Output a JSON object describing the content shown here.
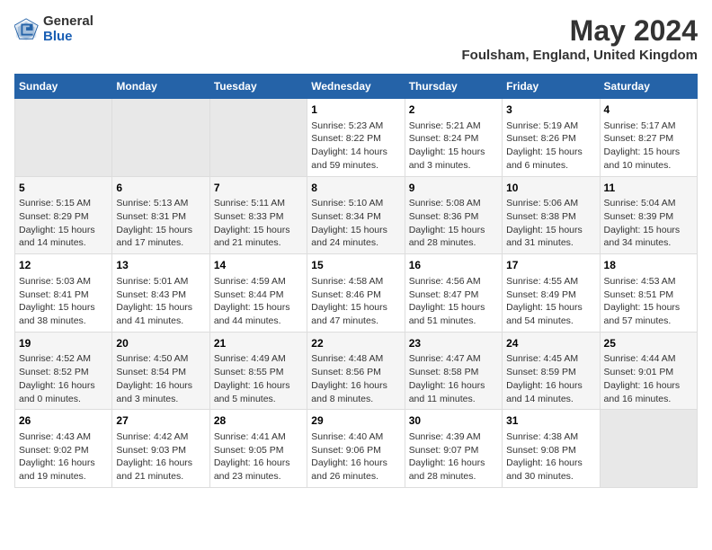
{
  "header": {
    "logo_general": "General",
    "logo_blue": "Blue",
    "title": "May 2024",
    "subtitle": "Foulsham, England, United Kingdom"
  },
  "days_of_week": [
    "Sunday",
    "Monday",
    "Tuesday",
    "Wednesday",
    "Thursday",
    "Friday",
    "Saturday"
  ],
  "weeks": [
    [
      {
        "num": "",
        "info": ""
      },
      {
        "num": "",
        "info": ""
      },
      {
        "num": "",
        "info": ""
      },
      {
        "num": "1",
        "info": "Sunrise: 5:23 AM\nSunset: 8:22 PM\nDaylight: 14 hours\nand 59 minutes."
      },
      {
        "num": "2",
        "info": "Sunrise: 5:21 AM\nSunset: 8:24 PM\nDaylight: 15 hours\nand 3 minutes."
      },
      {
        "num": "3",
        "info": "Sunrise: 5:19 AM\nSunset: 8:26 PM\nDaylight: 15 hours\nand 6 minutes."
      },
      {
        "num": "4",
        "info": "Sunrise: 5:17 AM\nSunset: 8:27 PM\nDaylight: 15 hours\nand 10 minutes."
      }
    ],
    [
      {
        "num": "5",
        "info": "Sunrise: 5:15 AM\nSunset: 8:29 PM\nDaylight: 15 hours\nand 14 minutes."
      },
      {
        "num": "6",
        "info": "Sunrise: 5:13 AM\nSunset: 8:31 PM\nDaylight: 15 hours\nand 17 minutes."
      },
      {
        "num": "7",
        "info": "Sunrise: 5:11 AM\nSunset: 8:33 PM\nDaylight: 15 hours\nand 21 minutes."
      },
      {
        "num": "8",
        "info": "Sunrise: 5:10 AM\nSunset: 8:34 PM\nDaylight: 15 hours\nand 24 minutes."
      },
      {
        "num": "9",
        "info": "Sunrise: 5:08 AM\nSunset: 8:36 PM\nDaylight: 15 hours\nand 28 minutes."
      },
      {
        "num": "10",
        "info": "Sunrise: 5:06 AM\nSunset: 8:38 PM\nDaylight: 15 hours\nand 31 minutes."
      },
      {
        "num": "11",
        "info": "Sunrise: 5:04 AM\nSunset: 8:39 PM\nDaylight: 15 hours\nand 34 minutes."
      }
    ],
    [
      {
        "num": "12",
        "info": "Sunrise: 5:03 AM\nSunset: 8:41 PM\nDaylight: 15 hours\nand 38 minutes."
      },
      {
        "num": "13",
        "info": "Sunrise: 5:01 AM\nSunset: 8:43 PM\nDaylight: 15 hours\nand 41 minutes."
      },
      {
        "num": "14",
        "info": "Sunrise: 4:59 AM\nSunset: 8:44 PM\nDaylight: 15 hours\nand 44 minutes."
      },
      {
        "num": "15",
        "info": "Sunrise: 4:58 AM\nSunset: 8:46 PM\nDaylight: 15 hours\nand 47 minutes."
      },
      {
        "num": "16",
        "info": "Sunrise: 4:56 AM\nSunset: 8:47 PM\nDaylight: 15 hours\nand 51 minutes."
      },
      {
        "num": "17",
        "info": "Sunrise: 4:55 AM\nSunset: 8:49 PM\nDaylight: 15 hours\nand 54 minutes."
      },
      {
        "num": "18",
        "info": "Sunrise: 4:53 AM\nSunset: 8:51 PM\nDaylight: 15 hours\nand 57 minutes."
      }
    ],
    [
      {
        "num": "19",
        "info": "Sunrise: 4:52 AM\nSunset: 8:52 PM\nDaylight: 16 hours\nand 0 minutes."
      },
      {
        "num": "20",
        "info": "Sunrise: 4:50 AM\nSunset: 8:54 PM\nDaylight: 16 hours\nand 3 minutes."
      },
      {
        "num": "21",
        "info": "Sunrise: 4:49 AM\nSunset: 8:55 PM\nDaylight: 16 hours\nand 5 minutes."
      },
      {
        "num": "22",
        "info": "Sunrise: 4:48 AM\nSunset: 8:56 PM\nDaylight: 16 hours\nand 8 minutes."
      },
      {
        "num": "23",
        "info": "Sunrise: 4:47 AM\nSunset: 8:58 PM\nDaylight: 16 hours\nand 11 minutes."
      },
      {
        "num": "24",
        "info": "Sunrise: 4:45 AM\nSunset: 8:59 PM\nDaylight: 16 hours\nand 14 minutes."
      },
      {
        "num": "25",
        "info": "Sunrise: 4:44 AM\nSunset: 9:01 PM\nDaylight: 16 hours\nand 16 minutes."
      }
    ],
    [
      {
        "num": "26",
        "info": "Sunrise: 4:43 AM\nSunset: 9:02 PM\nDaylight: 16 hours\nand 19 minutes."
      },
      {
        "num": "27",
        "info": "Sunrise: 4:42 AM\nSunset: 9:03 PM\nDaylight: 16 hours\nand 21 minutes."
      },
      {
        "num": "28",
        "info": "Sunrise: 4:41 AM\nSunset: 9:05 PM\nDaylight: 16 hours\nand 23 minutes."
      },
      {
        "num": "29",
        "info": "Sunrise: 4:40 AM\nSunset: 9:06 PM\nDaylight: 16 hours\nand 26 minutes."
      },
      {
        "num": "30",
        "info": "Sunrise: 4:39 AM\nSunset: 9:07 PM\nDaylight: 16 hours\nand 28 minutes."
      },
      {
        "num": "31",
        "info": "Sunrise: 4:38 AM\nSunset: 9:08 PM\nDaylight: 16 hours\nand 30 minutes."
      },
      {
        "num": "",
        "info": ""
      }
    ]
  ]
}
